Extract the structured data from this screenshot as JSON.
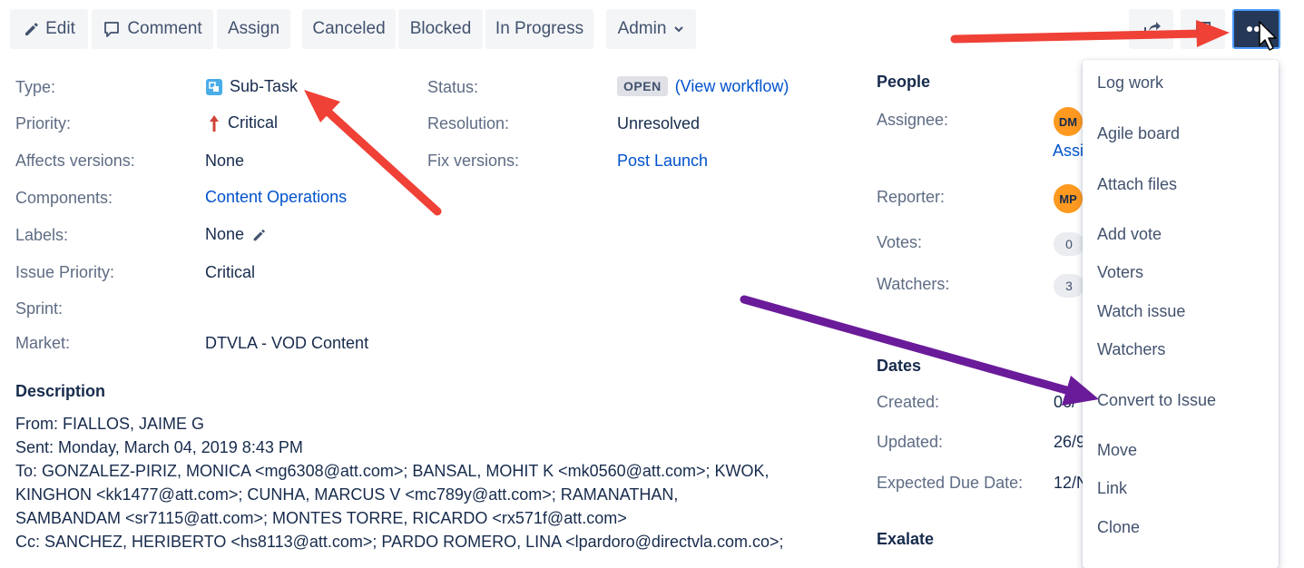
{
  "toolbar": {
    "edit": "Edit",
    "comment": "Comment",
    "assign": "Assign",
    "canceled": "Canceled",
    "blocked": "Blocked",
    "in_progress": "In Progress",
    "admin": "Admin"
  },
  "fields": {
    "type_label": "Type:",
    "type_value": "Sub-Task",
    "priority_label": "Priority:",
    "priority_value": "Critical",
    "affects_label": "Affects versions:",
    "affects_value": "None",
    "components_label": "Components:",
    "components_value": "Content Operations",
    "labels_label": "Labels:",
    "labels_value": "None",
    "issue_priority_label": "Issue Priority:",
    "issue_priority_value": "Critical",
    "sprint_label": "Sprint:",
    "market_label": "Market:",
    "market_value": "DTVLA - VOD Content",
    "status_label": "Status:",
    "status_value": "OPEN",
    "view_workflow": "(View workflow)",
    "resolution_label": "Resolution:",
    "resolution_value": "Unresolved",
    "fix_label": "Fix versions:",
    "fix_value": "Post Launch"
  },
  "description": {
    "heading": "Description",
    "lines": [
      "From: FIALLOS, JAIME G",
      "Sent: Monday, March 04, 2019 8:43 PM",
      "To: GONZALEZ-PIRIZ, MONICA <mg6308@att.com>; BANSAL, MOHIT K <mk0560@att.com>; KWOK,",
      "KINGHON <kk1477@att.com>; CUNHA, MARCUS V <mc789y@att.com>; RAMANATHAN,",
      "SAMBANDAM <sr7115@att.com>; MONTES TORRE, RICARDO <rx571f@att.com>",
      "Cc: SANCHEZ, HERIBERTO <hs8113@att.com>; PARDO ROMERO, LINA <lpardoro@directvla.com.co>;"
    ]
  },
  "people": {
    "heading": "People",
    "assignee_label": "Assignee:",
    "assignee_initials": "DM",
    "assign_link": "Assi",
    "reporter_label": "Reporter:",
    "reporter_initials": "MP",
    "votes_label": "Votes:",
    "votes_count": "0",
    "watchers_label": "Watchers:",
    "watchers_count": "3"
  },
  "dates": {
    "heading": "Dates",
    "created_label": "Created:",
    "created_value": "06/",
    "updated_label": "Updated:",
    "updated_value": "26/9",
    "due_label": "Expected Due Date:",
    "due_value": "12/N"
  },
  "exalate": {
    "heading": "Exalate"
  },
  "more_menu": {
    "items": [
      "Log work",
      "Agile board",
      "Attach files",
      "Add vote",
      "Voters",
      "Watch issue",
      "Watchers",
      "Convert to Issue",
      "Move",
      "Link",
      "Clone"
    ]
  },
  "icons": {
    "edit": "pencil-icon",
    "comment": "comment-icon",
    "admin_caret": "chevron-down-icon",
    "share": "share-icon",
    "export": "export-icon",
    "more": "more-dots-icon",
    "subtask": "subtask-icon",
    "priority": "arrow-up-icon",
    "labels_edit": "pencil-icon"
  },
  "colors": {
    "link": "#0052cc",
    "priority_critical": "#d04437",
    "subtask": "#4bade8",
    "avatar": "#ff991f",
    "annotation_red": "#ef4136",
    "annotation_purple": "#6a1b9a",
    "more_button": "#253858"
  }
}
